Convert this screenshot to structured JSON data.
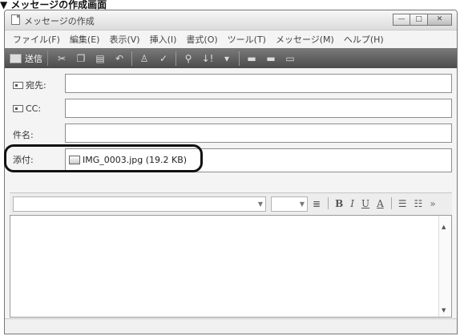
{
  "caption": "▼ メッセージの作成画面",
  "window": {
    "title": "メッセージの作成"
  },
  "menu": [
    "ファイル(F)",
    "編集(E)",
    "表示(V)",
    "挿入(I)",
    "書式(O)",
    "ツール(T)",
    "メッセージ(M)",
    "ヘルプ(H)"
  ],
  "toolbar": {
    "send_label": "送信",
    "icons": [
      "cut-icon",
      "copy-icon",
      "paste-icon",
      "undo-icon",
      "check-names-icon",
      "spelling-icon",
      "attach-icon",
      "priority-icon",
      "priority-dropdown-icon",
      "sign-icon",
      "encrypt-icon",
      "offline-icon"
    ]
  },
  "headers": {
    "to_label": "宛先:",
    "cc_label": "CC:",
    "subject_label": "件名:",
    "attach_label": "添付:"
  },
  "attachment": {
    "file": "IMG_0003.jpg (19.2 KB)"
  },
  "format": {
    "bold": "B",
    "italic": "I",
    "underline": "U",
    "color": "A"
  },
  "colors": {
    "toolbar": "#555555",
    "highlight": "#111111"
  }
}
